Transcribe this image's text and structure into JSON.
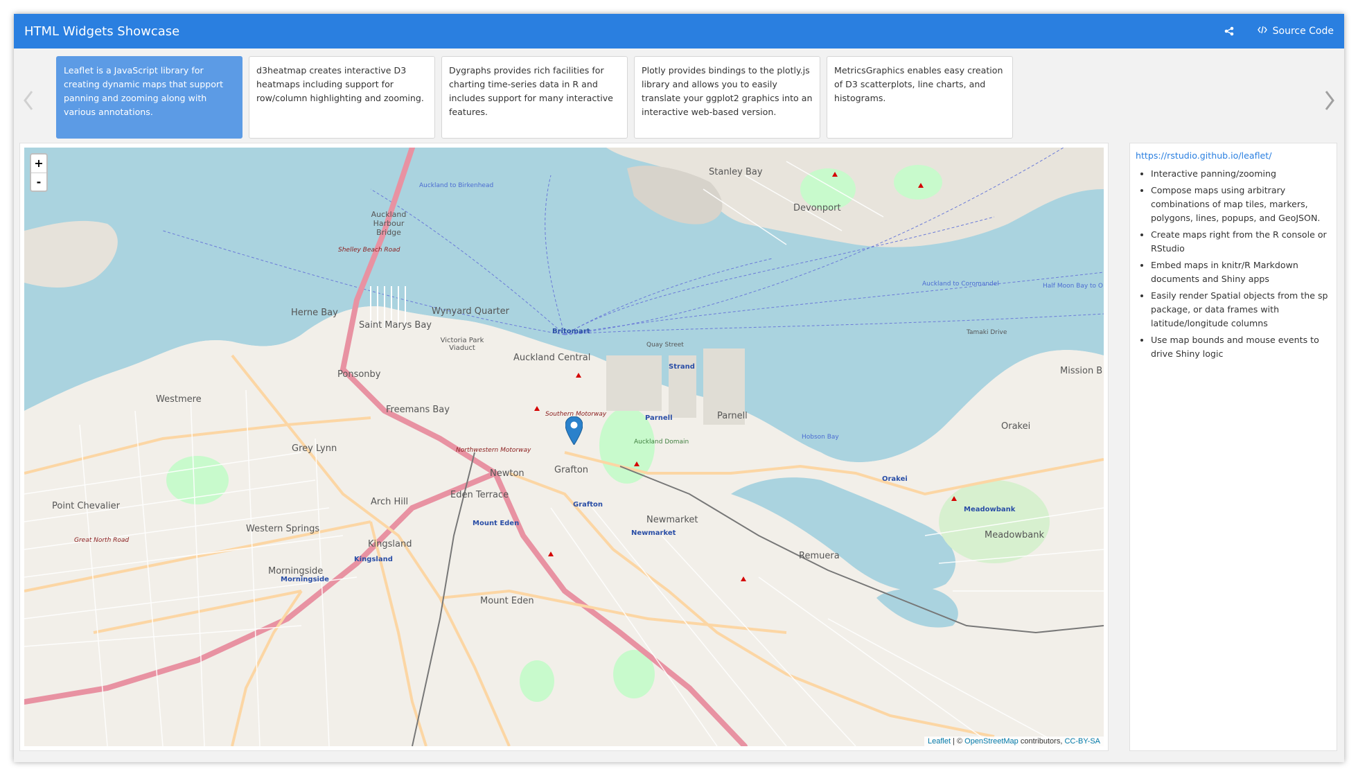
{
  "navbar": {
    "title": "HTML Widgets Showcase",
    "source_code_label": "Source Code",
    "share_icon": "share-icon",
    "code_icon": "code-icon"
  },
  "carousel": {
    "cards": [
      {
        "text": "Leaflet is a JavaScript library for creating dynamic maps that support panning and zooming along with various annotations."
      },
      {
        "text": "d3heatmap creates interactive D3 heatmaps including support for row/column highlighting and zooming."
      },
      {
        "text": "Dygraphs provides rich facilities for charting time-series data in R and includes support for many interactive features."
      },
      {
        "text": "Plotly provides bindings to the plotly.js library and allows you to easily translate your ggplot2 graphics into an interactive web-based version."
      },
      {
        "text": "MetricsGraphics enables easy creation of D3 scatterplots, line charts, and histograms."
      }
    ]
  },
  "map": {
    "zoom_in": "+",
    "zoom_out": "-",
    "attribution": {
      "leaflet": "Leaflet",
      "separator": " | © ",
      "osm": "OpenStreetMap",
      "contributors": " contributors, ",
      "license": "CC-BY-SA"
    },
    "labels": {
      "stanley_bay": "Stanley Bay",
      "devonport": "Devonport",
      "auckland_harbour_bridge": "Auckland Harbour Bridge",
      "herne_bay": "Herne Bay",
      "saint_marys_bay": "Saint Marys Bay",
      "wynyard_quarter": "Wynyard Quarter",
      "britomart": "Britomart",
      "auckland_central": "Auckland Central",
      "victoria_park_viaduct": "Victoria Park Viaduct",
      "ponsonby": "Ponsonby",
      "westmere": "Westmere",
      "freemans_bay": "Freemans Bay",
      "parnell": "Parnell",
      "grey_lynn": "Grey Lynn",
      "newton": "Newton",
      "grafton": "Grafton",
      "arch_hill": "Arch Hill",
      "eden_terrace": "Eden Terrace",
      "point_chevalier": "Point Chevalier",
      "western_springs": "Western Springs",
      "kingsland": "Kingsland",
      "morningside": "Morningside",
      "mount_eden": "Mount Eden",
      "newmarket": "Newmarket",
      "remuera": "Remuera",
      "meadowbank": "Meadowbank",
      "orakei": "Orakei",
      "mission_bay": "Mission B",
      "shelley_beach_road": "Shelley Beach Road",
      "southern_motorway": "Southern Motorway",
      "northwestern_motorway": "Northwestern Motorway",
      "great_north_road": "Great North Road",
      "auckland_domain": "Auckland Domain",
      "quay_street": "Quay Street",
      "tamaki_drive": "Tamaki Drive",
      "strand": "Strand",
      "hobson_bay": "Hobson Bay",
      "auckland_to_birkenhead": "Auckland to Birkenhead",
      "auckland_to_coromandel": "Auckland to Coromandel",
      "half_moon_bay": "Half Moon Bay to O"
    }
  },
  "side": {
    "link": "https://rstudio.github.io/leaflet/",
    "features": [
      "Interactive panning/zooming",
      "Compose maps using arbitrary combinations of map tiles, markers, polygons, lines, popups, and GeoJSON.",
      "Create maps right from the R console or RStudio",
      "Embed maps in knitr/R Markdown documents and Shiny apps",
      "Easily render Spatial objects from the sp package, or data frames with latitude/longitude columns",
      "Use map bounds and mouse events to drive Shiny logic"
    ]
  }
}
